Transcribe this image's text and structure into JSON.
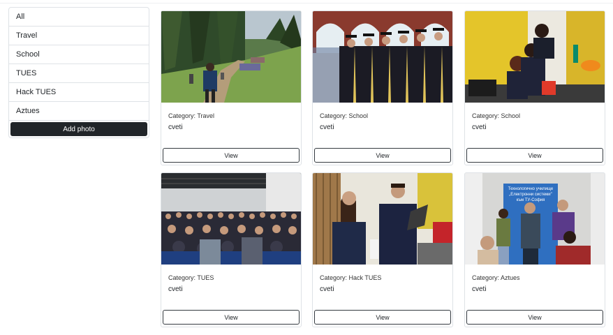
{
  "sidebar": {
    "items": [
      {
        "label": "All"
      },
      {
        "label": "Travel"
      },
      {
        "label": "School"
      },
      {
        "label": "TUES"
      },
      {
        "label": "Hack TUES"
      },
      {
        "label": "Aztues"
      }
    ],
    "add_photo_label": "Add photo"
  },
  "cards": [
    {
      "category": "Category: Travel",
      "author": "cveti",
      "view_label": "View"
    },
    {
      "category": "Category: School",
      "author": "cveti",
      "view_label": "View"
    },
    {
      "category": "Category: School",
      "author": "cveti",
      "view_label": "View"
    },
    {
      "category": "Category: TUES",
      "author": "cveti",
      "view_label": "View"
    },
    {
      "category": "Category: Hack TUES",
      "author": "cveti",
      "view_label": "View"
    },
    {
      "category": "Category: Aztues",
      "author": "cveti",
      "view_label": "View"
    }
  ],
  "photo6_sign": {
    "line1": "Технологично училище",
    "line2": "„Електронни системи\"",
    "line3": "към ТУ-София"
  }
}
